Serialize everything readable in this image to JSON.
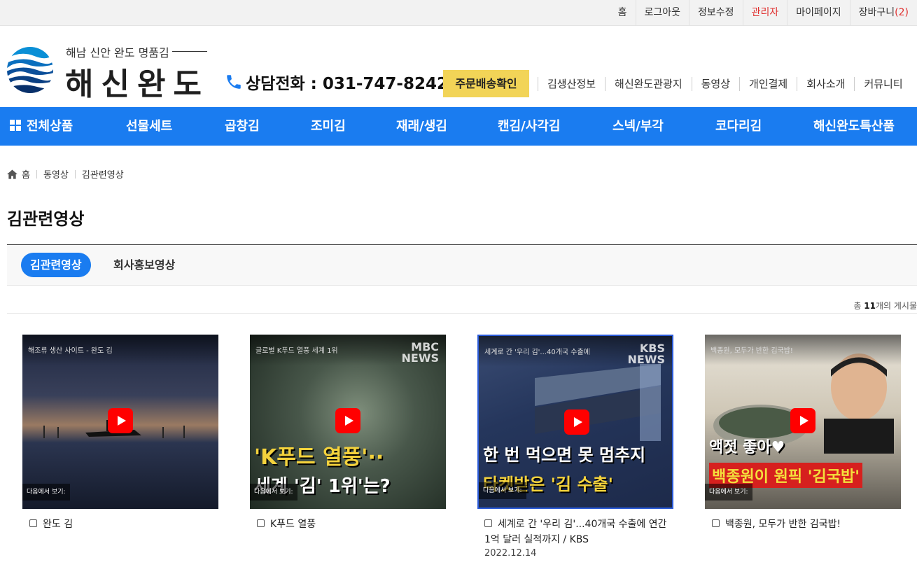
{
  "topbar": {
    "items": [
      "홈",
      "로그아웃",
      "정보수정",
      "관리자",
      "마이페이지"
    ],
    "cart_label": "장바구니",
    "cart_count": "2",
    "cart_open": "(",
    "cart_close": ")"
  },
  "header": {
    "logo_sub": "해남 신안 완도 명품김",
    "logo_main": "해신완도",
    "phone_label": "상담전화 : 031-747-8242",
    "order_button": "주문배송확인",
    "nav": [
      "김생산정보",
      "해신완도관광지",
      "동영상",
      "개인결제",
      "회사소개",
      "커뮤니티"
    ]
  },
  "gnb": {
    "all_products": "전체상품",
    "items": [
      "선물세트",
      "곱창김",
      "조미김",
      "재래/생김",
      "캔김/사각김",
      "스넥/부각",
      "코다리김",
      "해신완도특산품"
    ]
  },
  "breadcrumb": [
    "홈",
    "동영상",
    "김관련영상"
  ],
  "page_title": "김관련영상",
  "tabs": [
    "김관련영상",
    "회사홍보영상"
  ],
  "total": {
    "prefix": "총 ",
    "count": "11",
    "suffix": "개의 게시물"
  },
  "videos": [
    {
      "title": "완도 김",
      "date": "",
      "thumb_title": "해조류 생산 사이트 - 완도 김",
      "overlay1": "",
      "overlay2": "",
      "watch_on": "다음에서 보기:",
      "colors": {
        "bg1": "#2b3550",
        "bg2": "#8a6a52"
      }
    },
    {
      "title": "K푸드 열풍",
      "date": "",
      "thumb_title": "글로벌 K푸드 열풍 세계 1위",
      "overlay1": "'K푸드 열풍'··",
      "overlay2": "세계 '김' 1위'는?",
      "watch_on": "다음에서 보기:",
      "colors": {
        "bg1": "#2c3a2e",
        "bg2": "#5c6f5a"
      }
    },
    {
      "title": "세계로 간 '우리 김'...40개국 수출에 연간 1억 달러 실적까지 / KBS",
      "date": "2022.12.14",
      "thumb_title": "세계로 간 '우리 김'...40개국 수출에",
      "overlay1": "한 번 먹으면 못 멈추지",
      "overlay2": "타켓받은 '김 수출'",
      "watch_on": "다음에서 보기:",
      "colors": {
        "bg1": "#1a2b54",
        "bg2": "#3b4a6c"
      }
    },
    {
      "title": "백종원, 모두가 반한 김국밥!",
      "date": "",
      "thumb_title": "백종원, 모두가 반한 김국밥!",
      "overlay1": "액젓 좋아♥",
      "overlay2": "백종원이 원픽 '김국밥'",
      "watch_on": "다음에서 보기:",
      "colors": {
        "bg1": "#d9d4c8",
        "bg2": "#8a7a62"
      }
    }
  ],
  "colors": {
    "accent": "#1a7cf0",
    "order_btn": "#f2d457",
    "admin": "#e0302f",
    "youtube_red": "#ff0000"
  },
  "icons": [
    "phone-icon",
    "grid-icon",
    "home-icon",
    "youtube-play-icon"
  ]
}
